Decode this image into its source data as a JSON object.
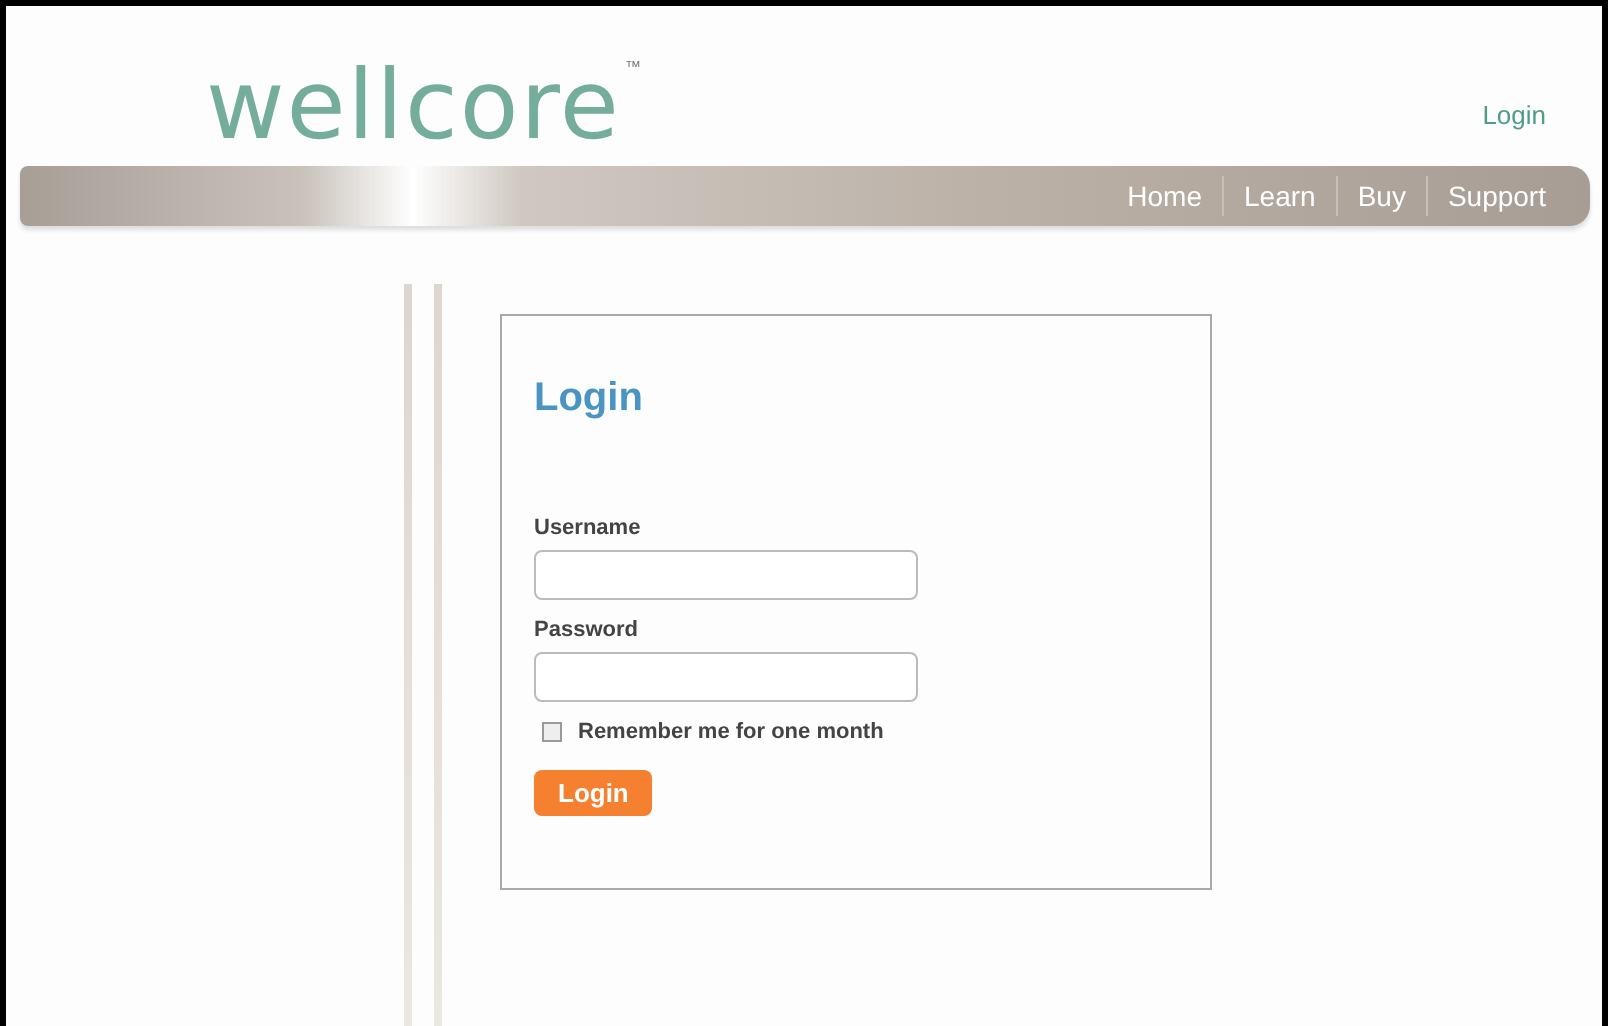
{
  "header": {
    "logo": "wellcore",
    "trademark": "™",
    "login_link": "Login"
  },
  "nav": [
    {
      "label": "Home"
    },
    {
      "label": "Learn"
    },
    {
      "label": "Buy"
    },
    {
      "label": "Support"
    }
  ],
  "login_form": {
    "title": "Login",
    "fields": [
      {
        "label": "Username"
      },
      {
        "label": "Password"
      }
    ],
    "remember": {
      "label": "Remember me for one month",
      "checked": false
    },
    "button": "Login"
  }
}
